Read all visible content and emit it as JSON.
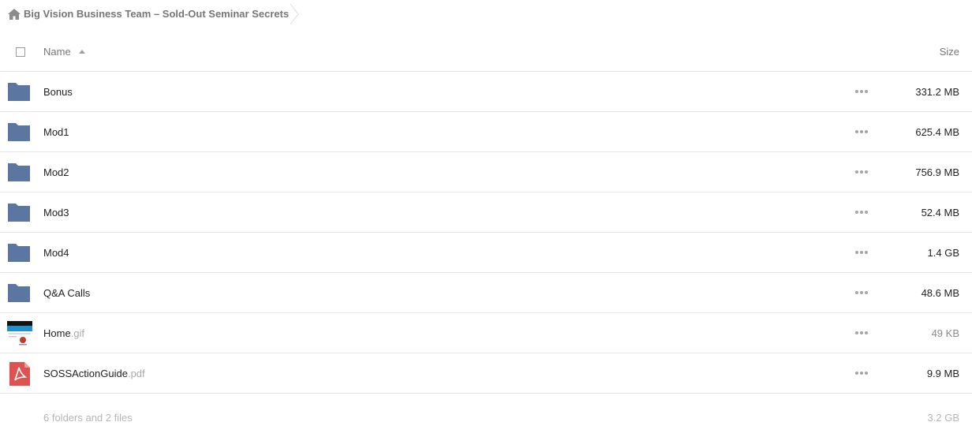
{
  "breadcrumb": {
    "label": "Big Vision Business Team – Sold-Out Seminar Secrets"
  },
  "header": {
    "name_label": "Name",
    "size_label": "Size",
    "sort_icon": "triangle-up-icon"
  },
  "files": [
    {
      "name": "Bonus",
      "ext": "",
      "size": "331.2 MB",
      "type": "folder"
    },
    {
      "name": "Mod1",
      "ext": "",
      "size": "625.4 MB",
      "type": "folder"
    },
    {
      "name": "Mod2",
      "ext": "",
      "size": "756.9 MB",
      "type": "folder"
    },
    {
      "name": "Mod3",
      "ext": "",
      "size": "52.4 MB",
      "type": "folder"
    },
    {
      "name": "Mod4",
      "ext": "",
      "size": "1.4 GB",
      "type": "folder"
    },
    {
      "name": "Q&A Calls",
      "ext": "",
      "size": "48.6 MB",
      "type": "folder"
    },
    {
      "name": "Home",
      "ext": ".gif",
      "size": "49 KB",
      "type": "image"
    },
    {
      "name": "SOSSActionGuide",
      "ext": ".pdf",
      "size": "9.9 MB",
      "type": "pdf"
    }
  ],
  "summary": {
    "text": "6 folders and 2 files",
    "size": "3.2 GB"
  },
  "colors": {
    "folder": "#5a76a1",
    "pdf": "#e05252",
    "muted_text": "#767676"
  }
}
